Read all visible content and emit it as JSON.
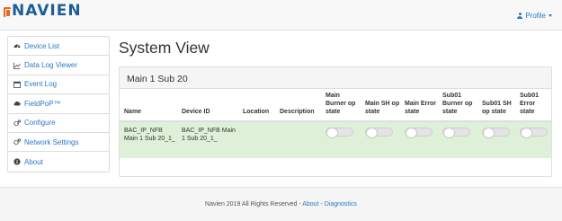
{
  "brand": {
    "logo_text": "NAVIEN"
  },
  "header": {
    "profile_label": "Profile"
  },
  "sidebar": {
    "items": [
      {
        "label": "Device List",
        "icon": "dashboard-icon"
      },
      {
        "label": "Data Log Viewer",
        "icon": "line-chart-icon"
      },
      {
        "label": "Event Log",
        "icon": "calendar-icon"
      },
      {
        "label": "FieldPoP™",
        "icon": "cloud-icon"
      },
      {
        "label": "Configure",
        "icon": "cogs-icon"
      },
      {
        "label": "Network Settings",
        "icon": "cogs-icon"
      },
      {
        "label": "About",
        "icon": "info-circle-icon"
      }
    ]
  },
  "page": {
    "title": "System View"
  },
  "panel": {
    "heading": "Main 1 Sub 20",
    "columns": {
      "name": "Name",
      "device_id": "Device ID",
      "location": "Location",
      "description": "Description",
      "main_burner": "Main Burner op state",
      "main_sh": "Main SH op state",
      "main_error": "Main Error state",
      "sub_burner": "Sub01 Burner op state",
      "sub_sh": "Sub01 SH op state",
      "sub_error": "Sub01 Error state"
    },
    "row": {
      "name": "BAC_IP_NFB Main 1 Sub 20_1_",
      "device_id": "BAC_IP_NFB Main 1 Sub 20_1_",
      "location": "",
      "description": "",
      "toggles": [
        false,
        false,
        false,
        false,
        false,
        false
      ]
    }
  },
  "footer": {
    "text": "Navien 2019 All Rights Reserved - ",
    "about_link": "About",
    "separator": " - ",
    "diagnostics_link": "Diagnostics"
  },
  "colors": {
    "brand_blue": "#1d5e97",
    "brand_orange": "#e9661a",
    "link_blue": "#2a78c5",
    "row_success": "#dff0d8"
  }
}
